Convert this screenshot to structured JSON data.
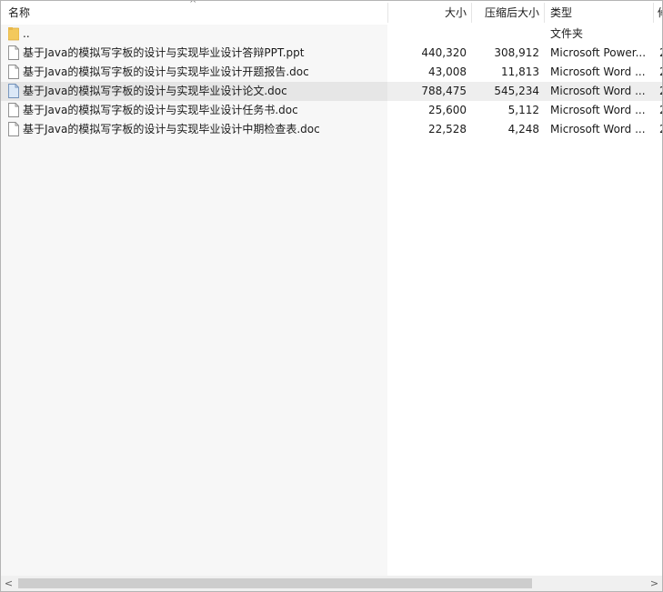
{
  "columns": {
    "name": "名称",
    "size": "大小",
    "compressed": "压缩后大小",
    "type": "类型",
    "extra": "修"
  },
  "rows": [
    {
      "name": "..",
      "size": "",
      "compressed": "",
      "type": "文件夹",
      "extra": "",
      "icon": "folder-icon"
    },
    {
      "name": "基于Java的模拟写字板的设计与实现毕业设计答辩PPT.ppt",
      "size": "440,320",
      "compressed": "308,912",
      "type": "Microsoft Power...",
      "extra": "2",
      "icon": "file-icon"
    },
    {
      "name": "基于Java的模拟写字板的设计与实现毕业设计开题报告.doc",
      "size": "43,008",
      "compressed": "11,813",
      "type": "Microsoft Word ...",
      "extra": "2",
      "icon": "file-icon"
    },
    {
      "name": "基于Java的模拟写字板的设计与实现毕业设计论文.doc",
      "size": "788,475",
      "compressed": "545,234",
      "type": "Microsoft Word ...",
      "extra": "2",
      "icon": "file-icon",
      "selected": true
    },
    {
      "name": "基于Java的模拟写字板的设计与实现毕业设计任务书.doc",
      "size": "25,600",
      "compressed": "5,112",
      "type": "Microsoft Word ...",
      "extra": "2",
      "icon": "file-icon"
    },
    {
      "name": "基于Java的模拟写字板的设计与实现毕业设计中期检查表.doc",
      "size": "22,528",
      "compressed": "4,248",
      "type": "Microsoft Word ...",
      "extra": "2",
      "icon": "file-icon"
    }
  ],
  "scrollbar": {
    "left_arrow": "<",
    "right_arrow": ">"
  },
  "colors": {
    "folder": "#f3c95c",
    "folder_dark": "#dba93a",
    "selected_row": "#eeeeee",
    "name_column_bg": "#f7f7f7"
  }
}
